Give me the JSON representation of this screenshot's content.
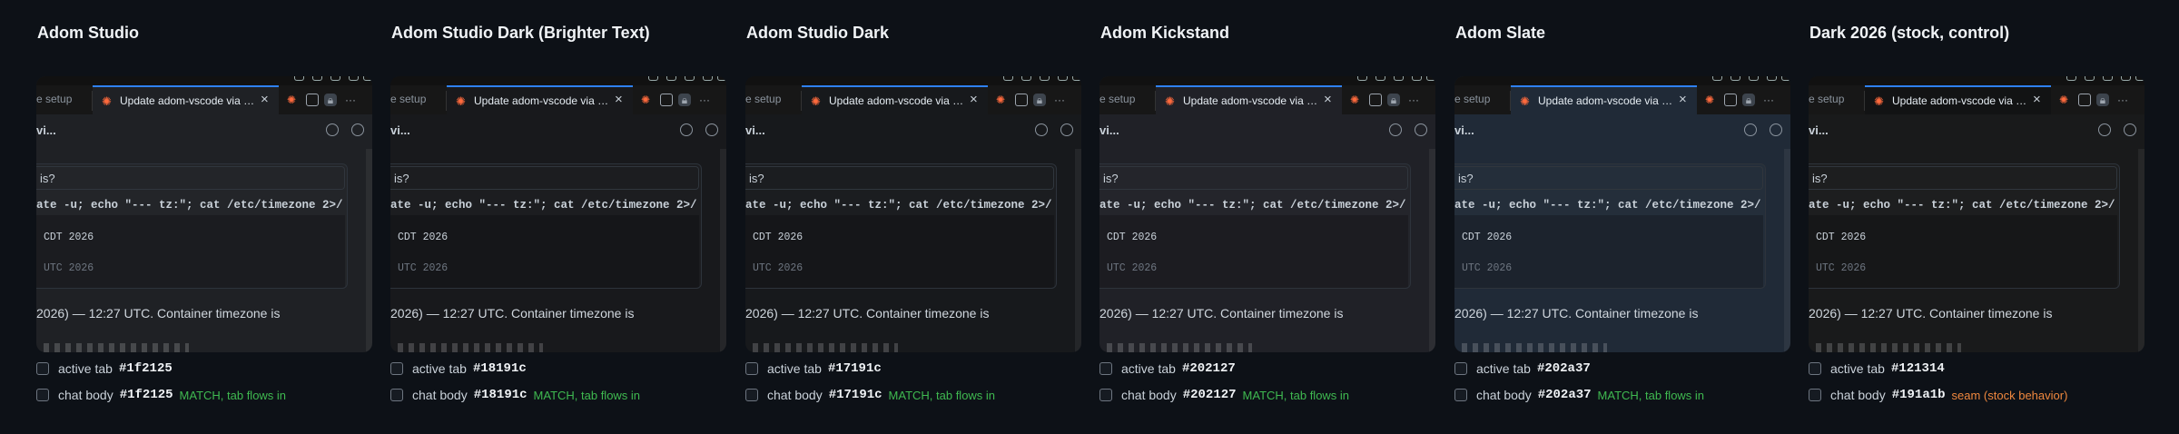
{
  "common": {
    "inactive_tab": "e setup",
    "active_tab_title": "Update adom-vscode via a...",
    "toolbar_prefix": "vi...",
    "question_fragment": "is?",
    "command": "ate -u; echo \"--- tz:\"; cat /etc/timezone 2>/",
    "output_line1": "CDT 2026",
    "output_line2": "UTC 2026",
    "paragraph": "2026) — 12:27 UTC. Container timezone is",
    "active_tab_label": "active tab",
    "chat_body_label": "chat body"
  },
  "colors": {
    "tab_accent": "#2f81f7",
    "match": "#3fb950",
    "seam": "#f0883e"
  },
  "themes": [
    {
      "name": "Adom Studio",
      "active_tab": "#1f2125",
      "chat_body": "#1f2125",
      "status": "MATCH, tab flows in",
      "status_kind": "match"
    },
    {
      "name": "Adom Studio Dark (Brighter Text)",
      "active_tab": "#18191c",
      "chat_body": "#18191c",
      "status": "MATCH, tab flows in",
      "status_kind": "match"
    },
    {
      "name": "Adom Studio Dark",
      "active_tab": "#17191c",
      "chat_body": "#17191c",
      "status": "MATCH, tab flows in",
      "status_kind": "match"
    },
    {
      "name": "Adom Kickstand",
      "active_tab": "#202127",
      "chat_body": "#202127",
      "status": "MATCH, tab flows in",
      "status_kind": "match"
    },
    {
      "name": "Adom Slate",
      "active_tab": "#202a37",
      "chat_body": "#202a37",
      "status": "MATCH, tab flows in",
      "status_kind": "match"
    },
    {
      "name": "Dark 2026 (stock, control)",
      "active_tab": "#121314",
      "chat_body": "#191a1b",
      "status": "seam (stock behavior)",
      "status_kind": "seam"
    }
  ]
}
